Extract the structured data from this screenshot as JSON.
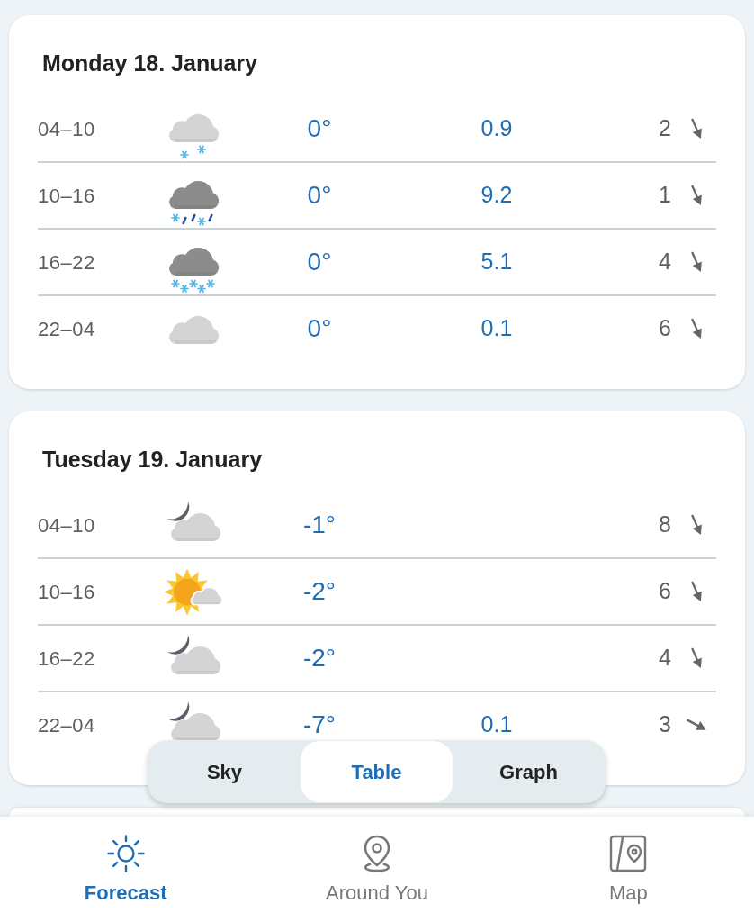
{
  "days": [
    {
      "title": "Monday 18. January",
      "periods": [
        {
          "time": "04–10",
          "kind": "lightsnow",
          "temperature": "0°",
          "precipitation": "0.9",
          "wind": "2",
          "wind_arrow": {
            "kind": "nnw"
          }
        },
        {
          "time": "10–16",
          "kind": "sleet",
          "temperature": "0°",
          "precipitation": "9.2",
          "wind": "1",
          "wind_arrow": {
            "kind": "nnw"
          }
        },
        {
          "time": "16–22",
          "kind": "snow",
          "temperature": "0°",
          "precipitation": "5.1",
          "wind": "4",
          "wind_arrow": {
            "kind": "nnw"
          }
        },
        {
          "time": "22–04",
          "kind": "cloudy",
          "temperature": "0°",
          "precipitation": "0.1",
          "wind": "6",
          "wind_arrow": {
            "kind": "nnw"
          }
        }
      ]
    },
    {
      "title": "Tuesday 19. January",
      "periods": [
        {
          "time": "04–10",
          "kind": "nightcloudy",
          "temperature": "-1°",
          "wind": "8",
          "wind_arrow": {
            "kind": "nnw"
          }
        },
        {
          "time": "10–16",
          "kind": "partlysunny",
          "temperature": "-2°",
          "wind": "6",
          "wind_arrow": {
            "kind": "nnw"
          }
        },
        {
          "time": "16–22",
          "kind": "nightcloudy",
          "temperature": "-2°",
          "wind": "4",
          "wind_arrow": {
            "kind": "nnw"
          }
        },
        {
          "time": "22–04",
          "kind": "nightcloudy",
          "temperature": "-7°",
          "precipitation": "0.1",
          "wind": "3",
          "wind_arrow": {
            "kind": "wnw"
          }
        }
      ]
    }
  ],
  "view_switch": [
    {
      "label": "Sky",
      "selected": false
    },
    {
      "label": "Table",
      "selected": true
    },
    {
      "label": "Graph",
      "selected": false
    }
  ],
  "bottom_nav": [
    {
      "label": "Forecast",
      "kind": "forecast",
      "selected": true
    },
    {
      "label": "Around You",
      "kind": "around",
      "selected": false
    },
    {
      "label": "Map",
      "kind": "map",
      "selected": false
    }
  ]
}
